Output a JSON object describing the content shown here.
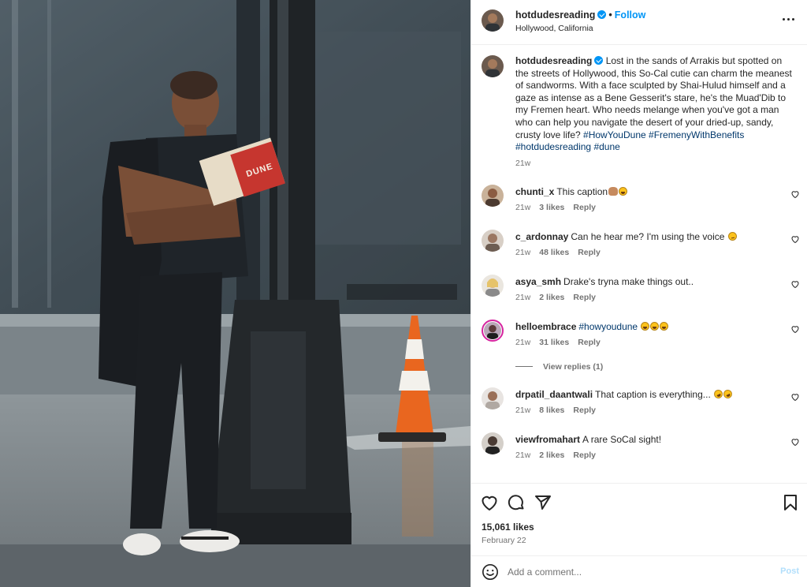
{
  "post": {
    "username": "hotdudesreading",
    "follow_label": "Follow",
    "separator": "•",
    "location": "Hollywood, California",
    "more_icon": "more-options-icon",
    "photo_book_title": "DUNE"
  },
  "caption": {
    "username": "hotdudesreading",
    "text": "Lost in the sands of Arrakis but spotted on the streets of Hollywood, this So-Cal cutie can charm the meanest of sandworms. With a face sculpted by Shai-Hulud himself and a gaze as intense as a Bene Gesserit's stare, he's the Muad'Dib to my Fremen heart. Who needs melange when you've got a man who can help you navigate the desert of your dried-up, sandy, crusty love life?",
    "hashtags": [
      "#HowYouDune",
      "#FremenyWithBenefits",
      "#hotdudesreading",
      "#dune"
    ],
    "time": "21w"
  },
  "comments": [
    {
      "username": "chunti_x",
      "text": "This caption",
      "time": "21w",
      "likes": "3 likes",
      "reply": "Reply",
      "emoji": [
        "hand-emoji",
        "laughing-emoji"
      ]
    },
    {
      "username": "c_ardonnay",
      "text": "Can he hear me? I'm using the voice",
      "time": "21w",
      "likes": "48 likes",
      "reply": "Reply",
      "emoji": [
        "smirk-emoji"
      ]
    },
    {
      "username": "asya_smh",
      "text": "Drake's tryna make things out..",
      "time": "21w",
      "likes": "2 likes",
      "reply": "Reply",
      "emoji": []
    },
    {
      "username": "helloembrace",
      "text": "#howyoudune",
      "time": "21w",
      "likes": "31 likes",
      "reply": "Reply",
      "emoji": [
        "laughing-emoji",
        "laughing-emoji",
        "laughing-emoji"
      ],
      "view_replies": "View replies (1)"
    },
    {
      "username": "drpatil_daantwali",
      "text": "That caption is everything...",
      "time": "21w",
      "likes": "8 likes",
      "reply": "Reply",
      "emoji": [
        "rofl-emoji",
        "rofl-emoji"
      ]
    },
    {
      "username": "viewfromahart",
      "text": "A rare SoCal sight!",
      "time": "21w",
      "likes": "2 likes",
      "reply": "Reply",
      "emoji": []
    }
  ],
  "actions": {
    "likes": "15,061 likes",
    "date": "February 22"
  },
  "composer": {
    "placeholder": "Add a comment...",
    "post_label": "Post"
  },
  "colors": {
    "accent": "#0095f6",
    "hashtag": "#00376b",
    "muted": "#737373",
    "post_disabled": "#b2dffc"
  }
}
